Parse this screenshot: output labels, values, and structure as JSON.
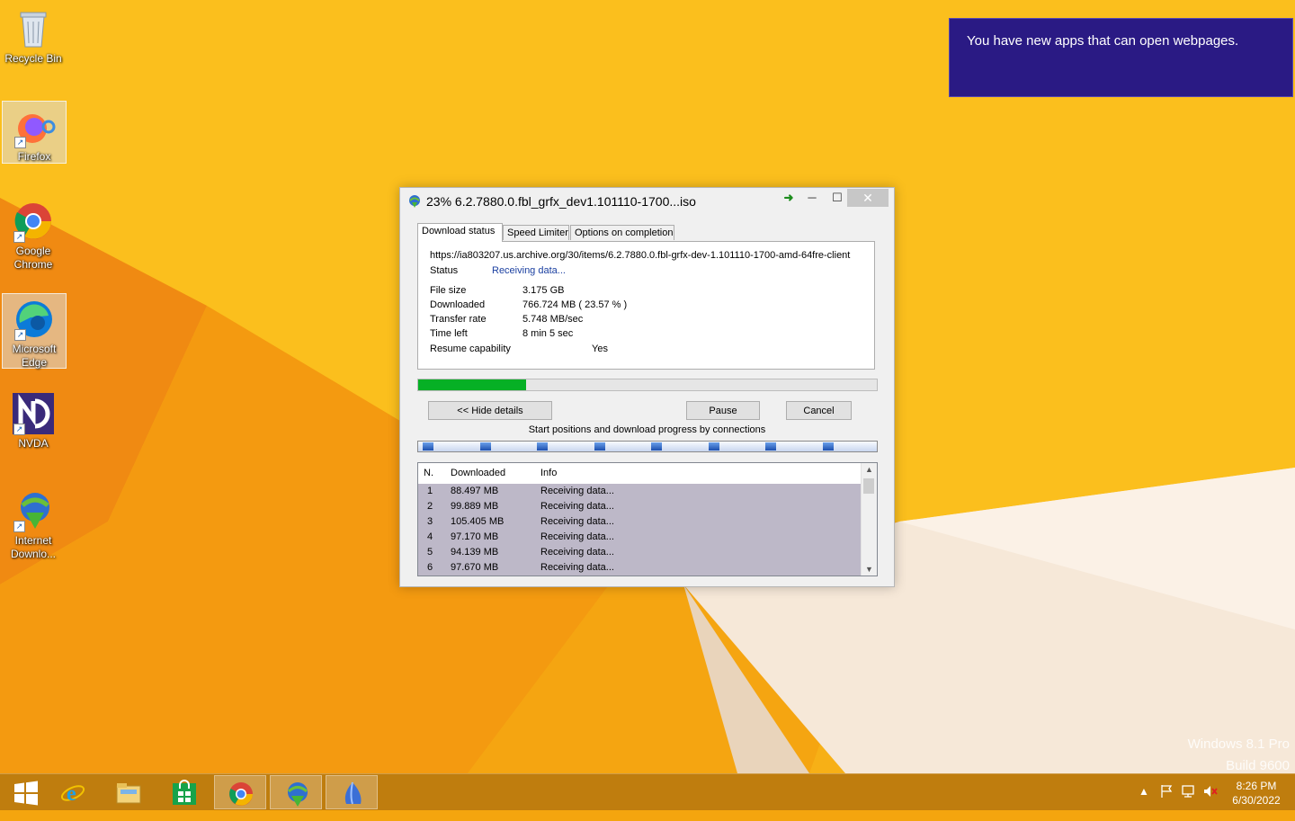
{
  "desktop": {
    "icons": [
      {
        "label": "Recycle Bin"
      },
      {
        "label": "Firefox"
      },
      {
        "label": "Google Chrome"
      },
      {
        "label": "Microsoft Edge"
      },
      {
        "label": "NVDA"
      },
      {
        "label": "Internet Downlo..."
      }
    ],
    "watermark": {
      "line1": "Windows 8.1 Pro",
      "line2": "Build 9600"
    }
  },
  "toast": {
    "message": "You have new apps that can open webpages."
  },
  "dialog": {
    "title": "23% 6.2.7880.0.fbl_grfx_dev1.101110-1700...iso",
    "tabs": [
      "Download status",
      "Speed Limiter",
      "Options on completion"
    ],
    "url": "https://ia803207.us.archive.org/30/items/6.2.7880.0.fbl-grfx-dev-1.101110-1700-amd-64fre-client",
    "status_label": "Status",
    "status_value": "Receiving data...",
    "details": [
      {
        "label": "File size",
        "value": "3.175  GB"
      },
      {
        "label": "Downloaded",
        "value": "766.724  MB  ( 23.57 % )"
      },
      {
        "label": "Transfer rate",
        "value": "5.748  MB/sec"
      },
      {
        "label": "Time left",
        "value": "8 min 5 sec"
      },
      {
        "label": "Resume capability",
        "value": "Yes"
      }
    ],
    "progress_fraction": 0.2357,
    "buttons": {
      "hide_details": "<< Hide details",
      "pause": "Pause",
      "cancel": "Cancel"
    },
    "connections_caption": "Start positions and download progress by connections",
    "connection_positions": [
      0.0,
      0.125,
      0.25,
      0.375,
      0.5,
      0.625,
      0.75,
      0.875
    ],
    "connection_progress": [
      0.025,
      0.028,
      0.03,
      0.027,
      0.026,
      0.027,
      0.025,
      0.026
    ],
    "columns": [
      "N.",
      "Downloaded",
      "Info"
    ],
    "rows": [
      {
        "n": "1",
        "downloaded": "88.497  MB",
        "info": "Receiving data..."
      },
      {
        "n": "2",
        "downloaded": "99.889  MB",
        "info": "Receiving data..."
      },
      {
        "n": "3",
        "downloaded": "105.405  MB",
        "info": "Receiving data..."
      },
      {
        "n": "4",
        "downloaded": "97.170  MB",
        "info": "Receiving data..."
      },
      {
        "n": "5",
        "downloaded": "94.139  MB",
        "info": "Receiving data..."
      },
      {
        "n": "6",
        "downloaded": "97.670  MB",
        "info": "Receiving data..."
      }
    ]
  },
  "taskbar": {
    "clock": {
      "time": "8:26 PM",
      "date": "6/30/2022"
    },
    "items": [
      "start",
      "internet-explorer",
      "file-explorer",
      "store",
      "chrome",
      "internet-download-manager",
      "app"
    ]
  },
  "colors": {
    "progress": "#06b025",
    "toast": "#2a1a84",
    "list_row": "#bdb8c8"
  }
}
